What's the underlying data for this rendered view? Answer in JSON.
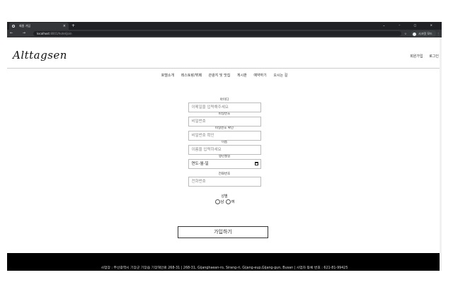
{
  "browser": {
    "tab_title": "회원 가입",
    "tab_close": "×",
    "new_tab": "+",
    "window_controls": "⌄ – ▢ ✕",
    "nav_buttons": "← → C",
    "url_host": "localhost",
    "url_path": ":8001/hotel/join",
    "bookmark": "☆",
    "profile_label": "시크릿 모드",
    "menu_dots": "⋮"
  },
  "header": {
    "logo": "Alttagsen",
    "signup": "회원가입",
    "login": "로그인"
  },
  "menu": [
    "호텔소개",
    "레스토랑/뷔페",
    "관광지 및 맛집",
    "게시판",
    "예약하기",
    "오시는 길"
  ],
  "form": {
    "id_label": "아이디",
    "id_placeholder": "이메일을 입력해주세요",
    "pw_label": "비밀번호",
    "pw_placeholder": "비밀번호",
    "pw_confirm_label": "비밀번호 확인",
    "pw_confirm_placeholder": "비밀번호 확인",
    "name_label": "이름",
    "name_placeholder": "이름을 입력하세요",
    "birth_label": "생년월일",
    "birth_value": "연도-월-일",
    "phone_label": "전화번호",
    "phone_placeholder": "전화번호",
    "gender_label": "성별",
    "gender_male": "남",
    "gender_female": "여",
    "submit": "가입하기"
  },
  "footer": {
    "text": "사업장 : 부산광역시 기장군 기장읍 기장해안로 268-31 | 268-31, Gijanghaean-ro, Sirang-ri, Gijang-eup,Gijang-gun, Busan | 사업자 등록 번호 : 621-81-99425"
  }
}
